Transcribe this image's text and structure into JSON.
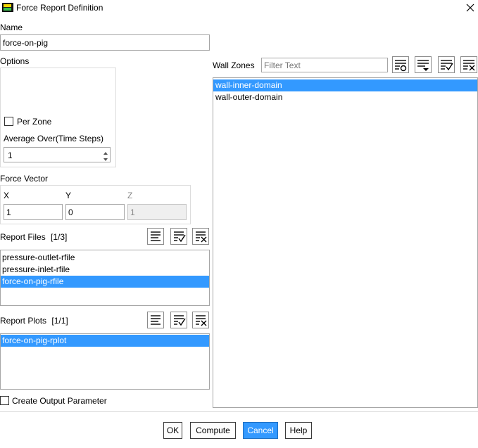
{
  "window": {
    "title": "Force Report Definition"
  },
  "name": {
    "label": "Name",
    "value": "force-on-pig"
  },
  "options": {
    "label": "Options",
    "per_zone_label": "Per Zone",
    "average_over_label": "Average Over(Time Steps)",
    "average_over_value": "1"
  },
  "force_vector": {
    "label": "Force Vector",
    "x_label": "X",
    "y_label": "Y",
    "z_label": "Z",
    "x_value": "1",
    "y_value": "0",
    "z_value": "1"
  },
  "report_files": {
    "label": "Report Files",
    "count": "[1/3]",
    "items": [
      {
        "label": "pressure-outlet-rfile",
        "selected": false
      },
      {
        "label": "pressure-inlet-rfile",
        "selected": false
      },
      {
        "label": "force-on-pig-rfile",
        "selected": true
      }
    ]
  },
  "report_plots": {
    "label": "Report Plots",
    "count": "[1/1]",
    "items": [
      {
        "label": "force-on-pig-rplot",
        "selected": true
      }
    ]
  },
  "create_output_parameter_label": "Create Output Parameter",
  "wall_zones": {
    "label": "Wall Zones",
    "filter_placeholder": "Filter Text",
    "items": [
      {
        "label": "wall-inner-domain",
        "selected": true
      },
      {
        "label": "wall-outer-domain",
        "selected": false
      }
    ]
  },
  "buttons": {
    "ok": "OK",
    "compute": "Compute",
    "cancel": "Cancel",
    "help": "Help"
  },
  "colors": {
    "selection": "#3399ff",
    "primary_button": "#3399ff"
  }
}
